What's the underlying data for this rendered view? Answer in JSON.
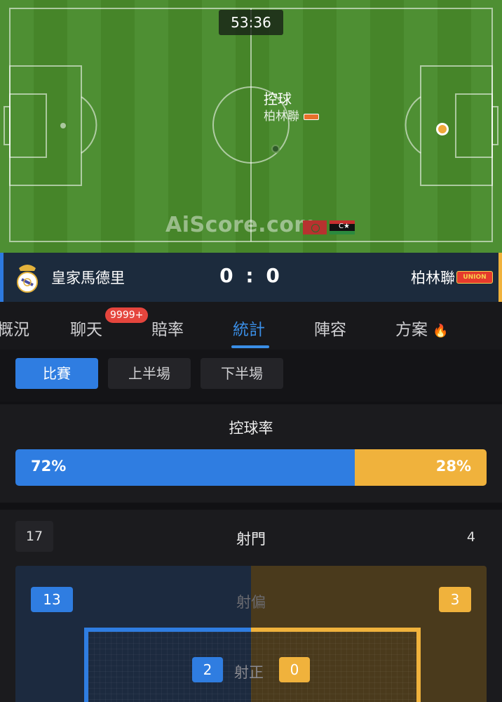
{
  "match": {
    "clock": "53:36",
    "possession_title": "控球",
    "possession_team": "柏林聯",
    "watermark": "AiScore.com",
    "flag_mark": "C★"
  },
  "scoreboard": {
    "home_team": "皇家馬德里",
    "score": "0 : 0",
    "away_team": "柏林聯",
    "away_logo_text": "UNION"
  },
  "tabs": {
    "items": [
      "概況",
      "聊天",
      "賠率",
      "統計",
      "陣容",
      "方案"
    ],
    "active": "統計",
    "chat_badge": "9999+",
    "fire_glyph": "🔥"
  },
  "periods": {
    "items": [
      "比賽",
      "上半場",
      "下半場"
    ],
    "active": "比賽"
  },
  "possession": {
    "label": "控球率",
    "home_text": "72%",
    "away_text": "28%",
    "home_fraction": 0.72
  },
  "shots": {
    "label": "射門",
    "home_total": "17",
    "away_total": "4",
    "off_target_label": "射偏",
    "home_off_target": "13",
    "away_off_target": "3",
    "on_target_label": "射正",
    "home_on_target": "2",
    "away_on_target": "0"
  },
  "colors": {
    "home": "#2f7de1",
    "away": "#f0b23c",
    "pitch": "#4a8a2f"
  }
}
